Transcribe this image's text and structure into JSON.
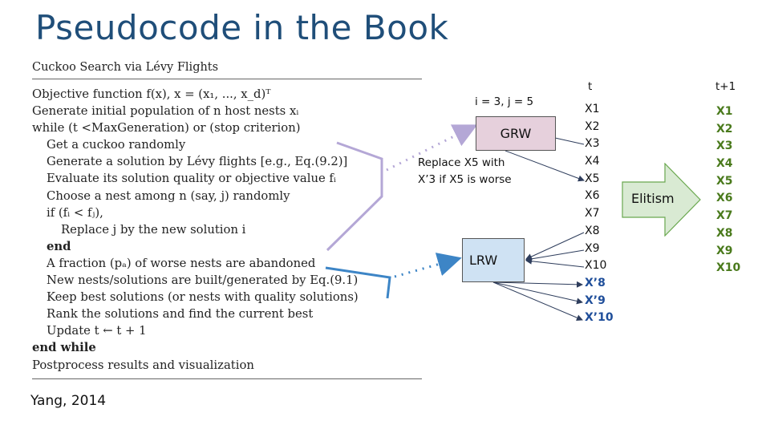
{
  "title": "Pseudocode in the Book",
  "algorithm": {
    "title": "Cuckoo Search via Lévy Flights",
    "lines": [
      {
        "text": "Objective function f(x),  x = (x₁, ..., x_d)ᵀ",
        "indent": 0,
        "bold": false
      },
      {
        "text": "Generate initial population of n host nests xᵢ",
        "indent": 0,
        "bold": false
      },
      {
        "text": "while (t <MaxGeneration) or (stop criterion)",
        "indent": 0,
        "bold": false
      },
      {
        "text": "Get a cuckoo randomly",
        "indent": 1,
        "bold": false
      },
      {
        "text": "Generate a solution by Lévy flights [e.g., Eq.(9.2)]",
        "indent": 1,
        "bold": false
      },
      {
        "text": "Evaluate its solution quality or objective value fᵢ",
        "indent": 1,
        "bold": false
      },
      {
        "text": "Choose a nest among n (say, j) randomly",
        "indent": 1,
        "bold": false
      },
      {
        "text": "if  (fᵢ < fⱼ),",
        "indent": 1,
        "bold": false
      },
      {
        "text": "Replace j by the new solution i",
        "indent": 2,
        "bold": false
      },
      {
        "text": "end",
        "indent": 1,
        "bold": true
      },
      {
        "text": "A fraction (pₐ) of worse nests are abandoned",
        "indent": 1,
        "bold": false
      },
      {
        "text": "New nests/solutions are built/generated by Eq.(9.1)",
        "indent": 1,
        "bold": false
      },
      {
        "text": "Keep best solutions (or nests with quality solutions)",
        "indent": 1,
        "bold": false
      },
      {
        "text": "Rank the solutions and find the current best",
        "indent": 1,
        "bold": false
      },
      {
        "text": "Update t ← t + 1",
        "indent": 1,
        "bold": false
      },
      {
        "text": "end while",
        "indent": 0,
        "bold": true
      },
      {
        "text": "Postprocess results and visualization",
        "indent": 0,
        "bold": false
      }
    ]
  },
  "citation": "Yang, 2014",
  "diagram": {
    "ij_label": "i = 3, j = 5",
    "grw_label": "GRW",
    "lrw_label": "LRW",
    "replace_note_line1": "Replace X5 with",
    "replace_note_line2": "X’3 if X5 is worse",
    "col_t_header": "t",
    "col_t1_header": "t+1",
    "col_t_items": [
      "X1",
      "X2",
      "X3",
      "X4",
      "X5",
      "X6",
      "X7",
      "X8",
      "X9",
      "X10"
    ],
    "col_t_new_items": [
      "X’8",
      "X’9",
      "X’10"
    ],
    "col_t1_items": [
      "X1",
      "X2",
      "X3",
      "X4",
      "X5",
      "X6",
      "X7",
      "X8",
      "X9",
      "X10"
    ],
    "elitism_label": "Elitism"
  },
  "colors": {
    "title": "#1f4e79",
    "grw_fill": "#e6d0dc",
    "lrw_fill": "#cfe2f3",
    "elitism_fill": "#d9ead3",
    "elitism_stroke": "#6aa84f",
    "t1_text": "#4a7a1c",
    "new_items_text": "#1f4e9a",
    "purple_bracket": "#b4a7d6",
    "blue_bracket": "#3d85c6"
  }
}
